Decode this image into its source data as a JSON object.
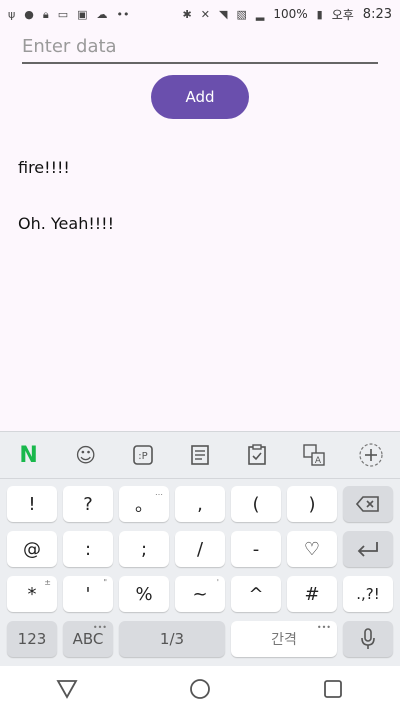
{
  "status_bar": {
    "battery_percent": "100%",
    "ampm": "오후",
    "time": "8:23"
  },
  "form": {
    "input_placeholder": "Enter data",
    "input_value": "",
    "add_label": "Add"
  },
  "items": [
    "fire!!!!",
    "Oh. Yeah!!!!"
  ],
  "keyboard": {
    "rows": [
      [
        {
          "label": "!",
          "hint": ""
        },
        {
          "label": "?",
          "hint": ""
        },
        {
          "label": "。",
          "hint": "…"
        },
        {
          "label": ",",
          "hint": ""
        },
        {
          "label": "(",
          "hint": ""
        },
        {
          "label": ")",
          "hint": ""
        }
      ],
      [
        {
          "label": "@",
          "hint": ""
        },
        {
          "label": ":",
          "hint": ""
        },
        {
          "label": ";",
          "hint": ""
        },
        {
          "label": "/",
          "hint": ""
        },
        {
          "label": "-",
          "hint": ""
        },
        {
          "label": "♡",
          "hint": ""
        }
      ],
      [
        {
          "label": "*",
          "hint": "±"
        },
        {
          "label": "'",
          "hint": "\""
        },
        {
          "label": "%",
          "hint": ""
        },
        {
          "label": "~",
          "hint": "'"
        },
        {
          "label": "^",
          "hint": ""
        },
        {
          "label": "#",
          "hint": ""
        }
      ]
    ],
    "special": {
      "enter_row3": ".,?!",
      "key_123": "123",
      "key_abc": "ABC",
      "key_page": "1/3",
      "key_space": "간격"
    }
  },
  "icons": {
    "toolbar": [
      "naver-n-icon",
      "emoji-icon",
      "sticker-icon",
      "memo-icon",
      "clipboard-icon",
      "translate-icon",
      "add-icon"
    ]
  }
}
